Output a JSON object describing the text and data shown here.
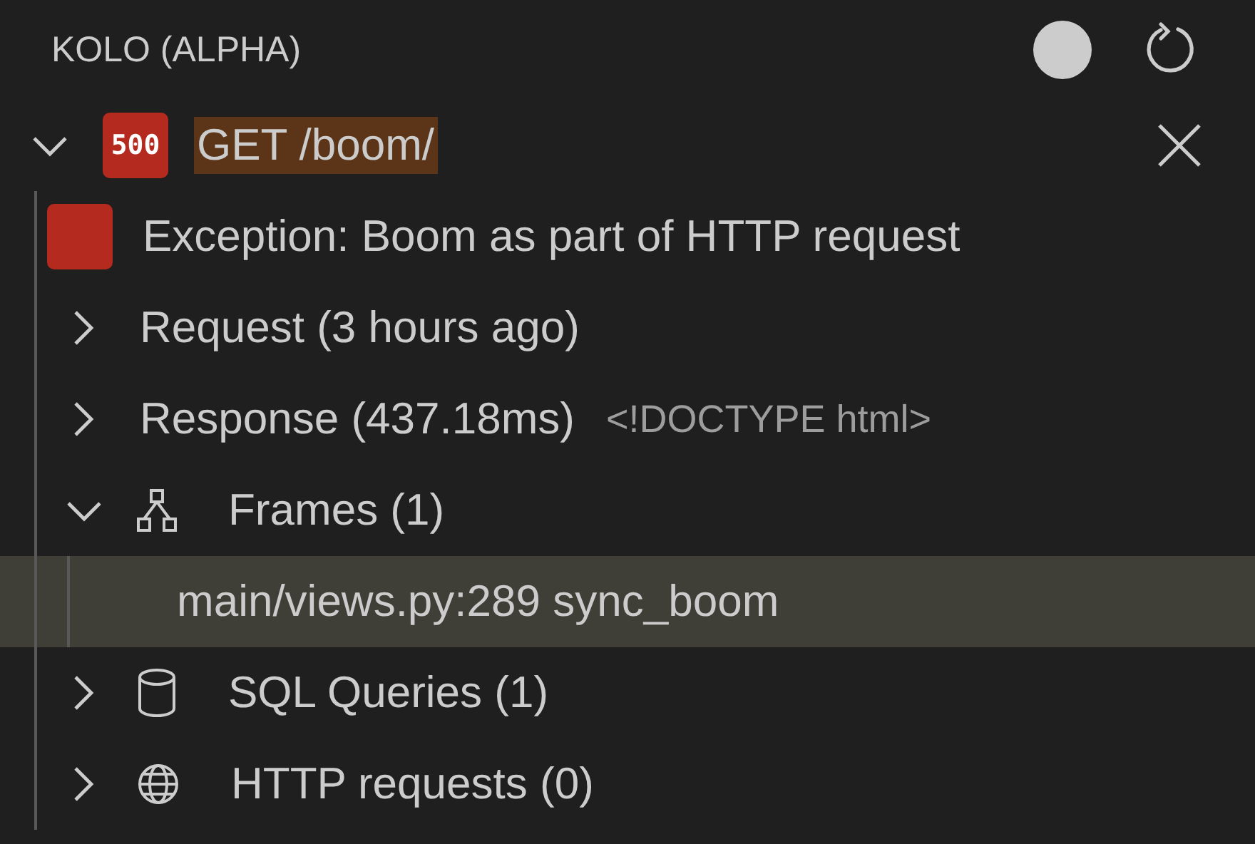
{
  "panel": {
    "title": "KOLO (ALPHA)"
  },
  "tree": {
    "status": "500",
    "label": "GET /boom/",
    "highlighted": true,
    "expanded": true,
    "children": [
      {
        "kind": "exception",
        "label": "Exception: Boom as part of HTTP request"
      },
      {
        "kind": "plain",
        "label": "Request (3 hours ago)",
        "expanded": false
      },
      {
        "kind": "plain",
        "label": "Response (437.18ms)",
        "description": "<!DOCTYPE html>",
        "expanded": false
      },
      {
        "kind": "frames",
        "label": "Frames (1)",
        "expanded": true,
        "children": [
          {
            "label": "main/views.py:289 sync_boom",
            "selected": true
          }
        ]
      },
      {
        "kind": "database",
        "label": "SQL Queries (1)",
        "expanded": false
      },
      {
        "kind": "network",
        "label": "HTTP requests (0)",
        "expanded": false
      }
    ]
  }
}
